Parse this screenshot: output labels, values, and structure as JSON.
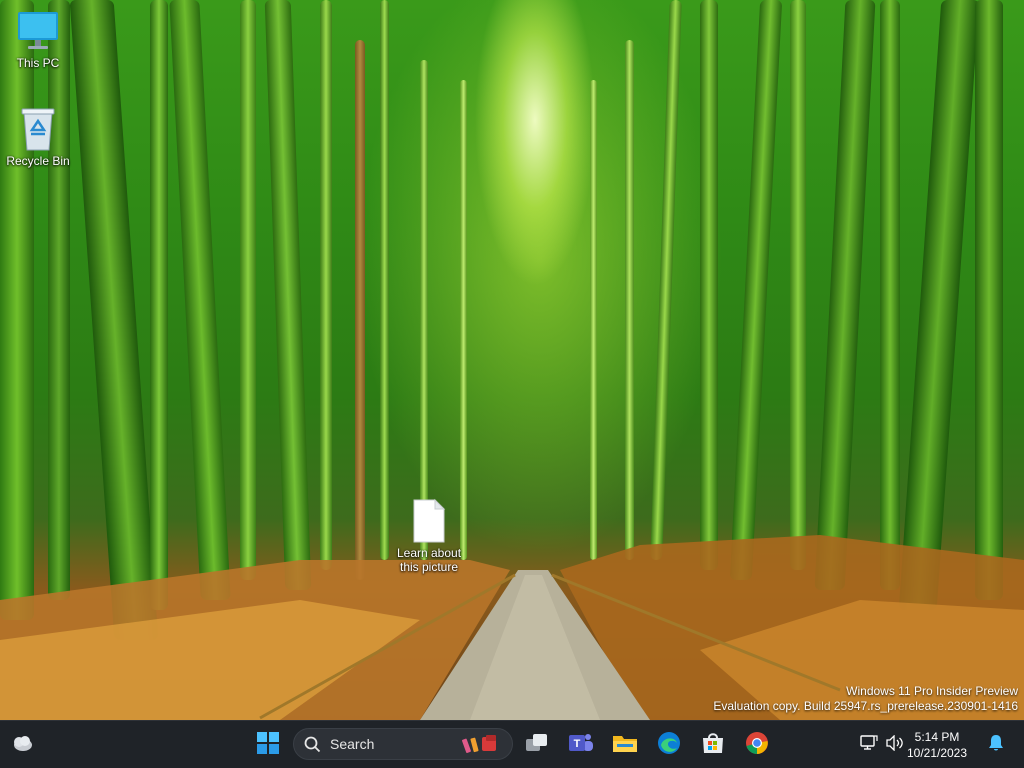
{
  "desktop": {
    "icons": [
      {
        "label": "This PC",
        "icon": "monitor-icon"
      },
      {
        "label": "Recycle Bin",
        "icon": "recycle-bin-icon"
      },
      {
        "label": "Learn about this picture",
        "label_line1": "Learn about",
        "label_line2": "this picture",
        "icon": "document-icon"
      }
    ],
    "watermark": {
      "line1": "Windows 11 Pro Insider Preview",
      "line2": "Evaluation copy. Build 25947.rs_prerelease.230901-1416"
    }
  },
  "taskbar": {
    "widgets_icon": "weather-widget-icon",
    "start_icon": "windows-start-icon",
    "search": {
      "label": "Search",
      "icon": "search-icon"
    },
    "apps": [
      {
        "name": "Task View",
        "icon": "task-view-icon"
      },
      {
        "name": "Microsoft Teams",
        "icon": "teams-icon"
      },
      {
        "name": "File Explorer",
        "icon": "file-explorer-icon"
      },
      {
        "name": "Microsoft Edge",
        "icon": "edge-icon"
      },
      {
        "name": "Microsoft Store",
        "icon": "store-icon"
      },
      {
        "name": "Google Chrome",
        "icon": "chrome-icon"
      }
    ],
    "tray": {
      "time": "5:14 PM",
      "date": "10/21/2023",
      "icons": [
        "network-icon",
        "volume-icon",
        "notification-bell-icon"
      ]
    },
    "colors": {
      "background": "#1f2328",
      "accent": "#1e90ff"
    }
  }
}
